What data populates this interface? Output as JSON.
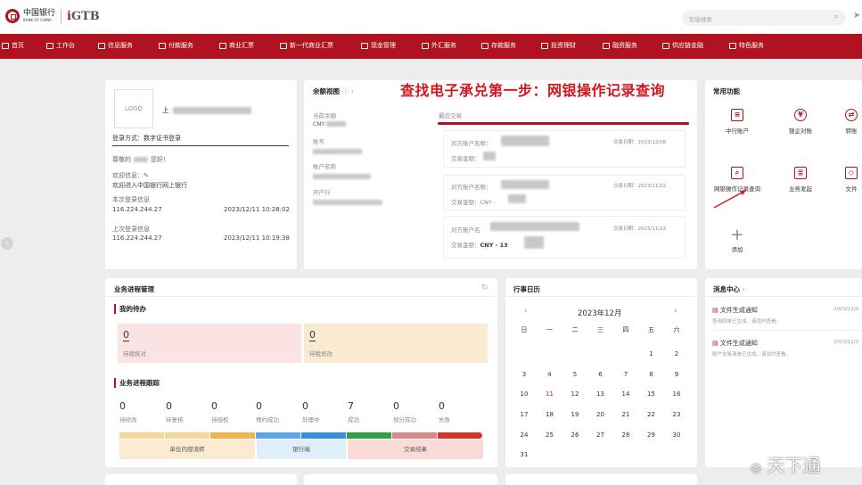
{
  "header": {
    "bank_name_cn": "中国银行",
    "bank_name_en": "BANK OF CHINA",
    "product": "GTB",
    "search_placeholder": "智能搜索"
  },
  "nav": [
    {
      "label": "首页",
      "icon": "home-icon"
    },
    {
      "label": "工作台",
      "icon": "workbench-icon"
    },
    {
      "label": "信息服务",
      "icon": "info-icon"
    },
    {
      "label": "付款服务",
      "icon": "payment-icon"
    },
    {
      "label": "商业汇票",
      "icon": "bill-icon"
    },
    {
      "label": "新一代商业汇票",
      "icon": "new-bill-icon"
    },
    {
      "label": "现金管理",
      "icon": "cash-icon"
    },
    {
      "label": "外汇服务",
      "icon": "forex-icon"
    },
    {
      "label": "存款服务",
      "icon": "deposit-icon"
    },
    {
      "label": "投资理财",
      "icon": "invest-icon"
    },
    {
      "label": "融资服务",
      "icon": "finance-icon"
    },
    {
      "label": "供应链金融",
      "icon": "supply-chain-icon"
    },
    {
      "label": "特色服务",
      "icon": "special-icon"
    }
  ],
  "user_card": {
    "logo": "LOGO",
    "name_prefix": "上",
    "login_method": "登录方式：数字证书登录",
    "greeting_prefix": "尊敬的",
    "greeting_suffix": "您好!",
    "welcome_label": "欢迎信息：",
    "welcome_text": "欢迎进入中国银行网上银行",
    "this_login_label": "本次登录信息",
    "this_login_ip": "116.224.244.27",
    "this_login_time": "2023/12/11 10:28:02",
    "last_login_label": "上次登录信息",
    "last_login_ip": "116.224.244.27",
    "last_login_time": "2023/12/11 10:19:38"
  },
  "balance": {
    "title": "余额视图",
    "current_balance_label": "当前余额",
    "currency": "CNY",
    "account_no_label": "账号",
    "account_name_label": "账户名称",
    "bank_label": "开户行",
    "recent_txn_label": "最近交易"
  },
  "annotation": "查找电子承兑第一步：网银操作记录查询",
  "transactions": [
    {
      "counterparty_label": "对方账户名称：",
      "amount_label": "交易金额：",
      "amount": "",
      "date_label": "交易日期：",
      "date": "2023/12/08"
    },
    {
      "counterparty_label": "对方账户名称：",
      "amount_label": "交易金额：",
      "amount": "CNY -",
      "date_label": "交易日期：",
      "date": "2023/11/22"
    },
    {
      "counterparty_label": "对方账户名",
      "amount_label": "交易金额：",
      "amount": "CNY - 13",
      "date_label": "交易日期：",
      "date": "2023/11/22"
    }
  ],
  "functions": {
    "title": "常用功能",
    "items": [
      {
        "label": "中行账户",
        "icon": "account-icon"
      },
      {
        "label": "银企对账",
        "icon": "reconcile-icon"
      },
      {
        "label": "网银操作记录查询",
        "icon": "operation-record-icon"
      },
      {
        "label": "业务发起",
        "icon": "business-initiate-icon"
      },
      {
        "label": "添加",
        "icon": "add-icon"
      }
    ],
    "edge_labels": [
      "转账",
      "文件"
    ]
  },
  "business": {
    "title": "业务进程管理",
    "todo_title": "我的待办",
    "todo": [
      {
        "count": "0",
        "label": "待我核对"
      },
      {
        "count": "0",
        "label": "待我修改"
      }
    ],
    "track_title": "业务进程跟踪",
    "stats": [
      {
        "count": "0",
        "label": "待修改"
      },
      {
        "count": "0",
        "label": "待复核"
      },
      {
        "count": "0",
        "label": "待授权"
      },
      {
        "count": "0",
        "label": "预约成功"
      },
      {
        "count": "0",
        "label": "处理中"
      },
      {
        "count": "7",
        "label": "成功"
      },
      {
        "count": "0",
        "label": "部分成功"
      },
      {
        "count": "0",
        "label": "失败"
      }
    ],
    "stages": [
      "单位内部流转",
      "银行端",
      "交易结果"
    ],
    "colors": [
      "#f6d79c",
      "#f6d79c",
      "#eeb64f",
      "#5ca7e8",
      "#3a8fdb",
      "#2ea14a",
      "#d98b8b",
      "#d6342f"
    ]
  },
  "calendar": {
    "title": "行事日历",
    "month": "2023年12月",
    "weekdays": [
      "日",
      "一",
      "二",
      "三",
      "四",
      "五",
      "六"
    ],
    "today": "11",
    "weeks": [
      [
        "",
        "",
        "",
        "",
        "",
        "1",
        "2"
      ],
      [
        "3",
        "4",
        "5",
        "6",
        "7",
        "8",
        "9"
      ],
      [
        "10",
        "11",
        "12",
        "13",
        "14",
        "15",
        "16"
      ],
      [
        "17",
        "18",
        "19",
        "20",
        "21",
        "22",
        "23"
      ],
      [
        "24",
        "25",
        "26",
        "27",
        "28",
        "29",
        "30"
      ],
      [
        "31",
        "",
        "",
        "",
        "",
        "",
        ""
      ]
    ]
  },
  "messages": {
    "title": "消息中心",
    "items": [
      {
        "title": "文件生成通知",
        "desc": "查询回单已生成，请及时查看。",
        "date": "2023/12/0"
      },
      {
        "title": "文件生成通知",
        "desc": "账户交易清单已生成，请及时查看。",
        "date": "2023/12/0"
      }
    ]
  },
  "watermark": "天下通"
}
